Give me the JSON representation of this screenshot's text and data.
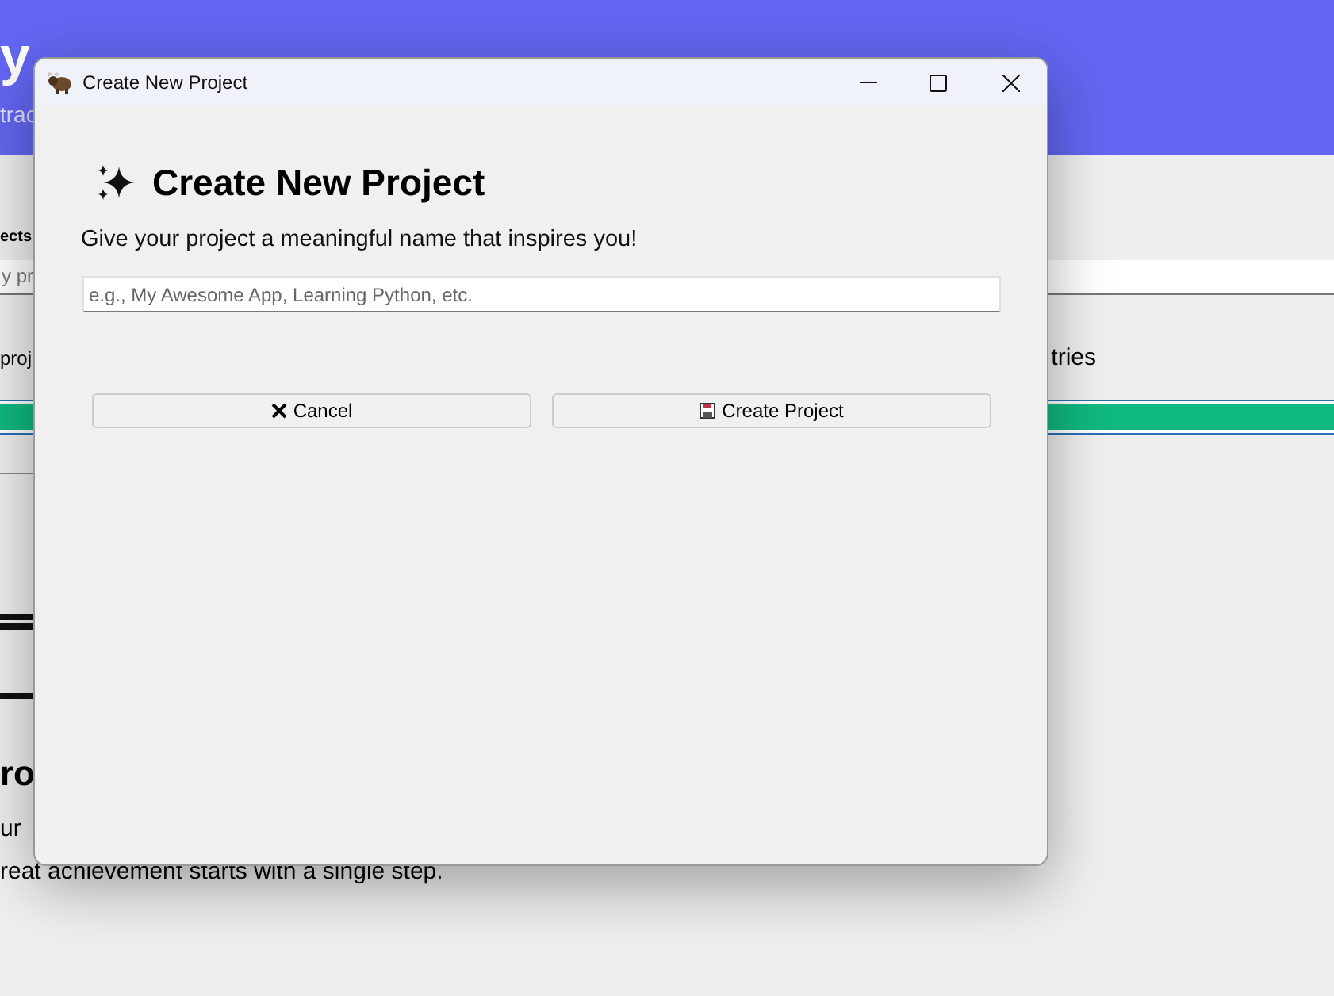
{
  "background_app": {
    "header": {
      "title": "y",
      "subtitle": "trac"
    },
    "section_label": "ects",
    "search": {
      "placeholder": "y pr"
    },
    "summary_left": "proj",
    "summary_right": "tries",
    "progress": {
      "level": 1
    },
    "empty_state": {
      "title": "ro",
      "line_1": "ur",
      "line_2": "reat achievement starts with a single step."
    }
  },
  "dialog": {
    "window_title": "Create New Project",
    "heading": "Create New Project",
    "prompt": "Give your project a meaningful name that inspires you!",
    "name_field": {
      "placeholder": "e.g., My Awesome App, Learning Python, etc."
    },
    "buttons": [
      {
        "kind": "cancel",
        "label": "Cancel"
      },
      {
        "kind": "save",
        "label": "Create Project"
      }
    ]
  }
}
